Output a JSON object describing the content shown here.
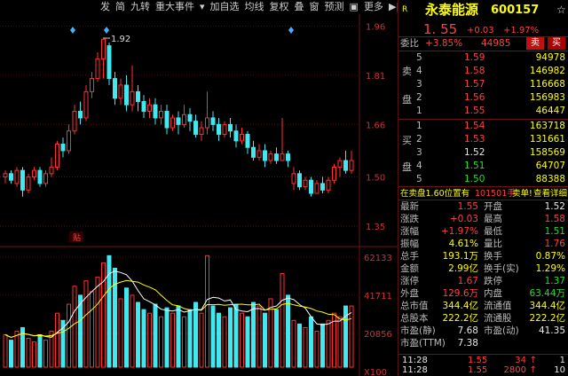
{
  "toolbar": {
    "items": [
      "发",
      "简",
      "九转",
      "重大事件",
      "加自选",
      "均线",
      "复权",
      "叠",
      "窗",
      "预测",
      "更多"
    ]
  },
  "stock": {
    "tag": "R",
    "name": "永泰能源",
    "code": "600157",
    "price": "1. 55",
    "change": "+0.03",
    "change_pct": "+1.97%",
    "star": "☆"
  },
  "weibi": {
    "label": "委比",
    "pct": "+3.85%",
    "value": "44985",
    "sell_btn": "卖",
    "buy_btn": "买"
  },
  "sell_orders": [
    {
      "level": "5",
      "price": "1.59",
      "vol": "94978"
    },
    {
      "level": "4",
      "price": "1.58",
      "vol": "146982"
    },
    {
      "level": "3",
      "price": "1.57",
      "vol": "116668"
    },
    {
      "level": "2",
      "price": "1.56",
      "vol": "156983"
    },
    {
      "level": "1",
      "price": "1.55",
      "vol": "46447"
    }
  ],
  "sell_side_label": [
    "卖",
    "盘"
  ],
  "buy_orders": [
    {
      "level": "1",
      "price": "1.54",
      "vol": "163718"
    },
    {
      "level": "2",
      "price": "1.53",
      "vol": "131661"
    },
    {
      "level": "3",
      "price": "1.52",
      "vol": "158569"
    },
    {
      "level": "4",
      "price": "1.51",
      "vol": "64707"
    },
    {
      "level": "5",
      "price": "1.50",
      "vol": "88388"
    }
  ],
  "buy_side_label": [
    "买",
    "盘"
  ],
  "notice": {
    "text_a": "在卖盘1.60位置有",
    "text_b": "101501手",
    "text_c": "卖单!",
    "link": "查看详细"
  },
  "stats": [
    {
      "l1": "最新",
      "v1": "1.55",
      "c1": "red",
      "l2": "开盘",
      "v2": "1.52",
      "c2": "white"
    },
    {
      "l1": "涨跌",
      "v1": "+0.03",
      "c1": "red",
      "l2": "最高",
      "v2": "1.58",
      "c2": "red"
    },
    {
      "l1": "涨幅",
      "v1": "+1.97%",
      "c1": "red",
      "l2": "最低",
      "v2": "1.51",
      "c2": "green"
    },
    {
      "l1": "振幅",
      "v1": "4.61%",
      "c1": "yellow",
      "l2": "量比",
      "v2": "1.76",
      "c2": "red"
    },
    {
      "l1": "总手",
      "v1": "193.1万",
      "c1": "yellow",
      "l2": "换手",
      "v2": "0.87%",
      "c2": "yellow"
    },
    {
      "l1": "金额",
      "v1": "2.99亿",
      "c1": "yellow",
      "l2": "换手(实)",
      "v2": "1.29%",
      "c2": "yellow"
    },
    {
      "l1": "涨停",
      "v1": "1.67",
      "c1": "red",
      "l2": "跌停",
      "v2": "1.37",
      "c2": "green"
    },
    {
      "l1": "外盘",
      "v1": "129.6万",
      "c1": "red",
      "l2": "内盘",
      "v2": "63.44万",
      "c2": "green"
    },
    {
      "l1": "总市值",
      "v1": "344.4亿",
      "c1": "yellow",
      "l2": "流通值",
      "v2": "344.4亿",
      "c2": "yellow"
    },
    {
      "l1": "总股本",
      "v1": "222.2亿",
      "c1": "yellow",
      "l2": "流通股",
      "v2": "222.2亿",
      "c2": "yellow"
    },
    {
      "l1": "市盈(静)",
      "v1": "7.68",
      "c1": "white",
      "l2": "市盈(动)",
      "v2": "41.35",
      "c2": "white"
    },
    {
      "l1": "市盈(TTM)",
      "v1": "7.38",
      "c1": "white",
      "l2": "",
      "v2": "",
      "c2": "white"
    }
  ],
  "ticks": [
    {
      "time": "11:28",
      "price": "1.55",
      "vol": "34",
      "arrow": "↑",
      "count": "1"
    },
    {
      "time": "11:28",
      "price": "1.55",
      "vol": "2800",
      "arrow": "↑",
      "count": "10"
    }
  ],
  "chart": {
    "price_axis": [
      "1.96",
      "1.81",
      "1.66",
      "1.50",
      "1.35"
    ],
    "volume_axis": [
      "62133",
      "41711",
      "20856",
      "X100"
    ],
    "high_annotation": "1.92",
    "event_label": "贴",
    "colors": {
      "up": "#ff3030",
      "down": "#40e8f0",
      "ma1": "#ffffff",
      "ma2": "#ffff00",
      "ma3": "#ff40ff"
    }
  },
  "chart_data": {
    "type": "candlestick",
    "ylim": [
      1.35,
      1.98
    ],
    "candles": [
      [
        1.5,
        1.51,
        1.48,
        1.52
      ],
      [
        1.51,
        1.49,
        1.48,
        1.52
      ],
      [
        1.48,
        1.52,
        1.47,
        1.53
      ],
      [
        1.52,
        1.46,
        1.44,
        1.53
      ],
      [
        1.46,
        1.5,
        1.45,
        1.51
      ],
      [
        1.5,
        1.52,
        1.49,
        1.53
      ],
      [
        1.52,
        1.48,
        1.47,
        1.53
      ],
      [
        1.48,
        1.51,
        1.47,
        1.52
      ],
      [
        1.51,
        1.53,
        1.5,
        1.56
      ],
      [
        1.53,
        1.6,
        1.52,
        1.61
      ],
      [
        1.6,
        1.58,
        1.56,
        1.62
      ],
      [
        1.58,
        1.64,
        1.57,
        1.66
      ],
      [
        1.64,
        1.7,
        1.63,
        1.72
      ],
      [
        1.7,
        1.68,
        1.66,
        1.73
      ],
      [
        1.68,
        1.76,
        1.67,
        1.78
      ],
      [
        1.76,
        1.8,
        1.74,
        1.82
      ],
      [
        1.8,
        1.86,
        1.79,
        1.88
      ],
      [
        1.86,
        1.92,
        1.8,
        1.92
      ],
      [
        1.9,
        1.8,
        1.78,
        1.91
      ],
      [
        1.8,
        1.74,
        1.72,
        1.82
      ],
      [
        1.74,
        1.78,
        1.72,
        1.8
      ],
      [
        1.78,
        1.72,
        1.7,
        1.81
      ],
      [
        1.72,
        1.76,
        1.7,
        1.84
      ],
      [
        1.76,
        1.73,
        1.7,
        1.78
      ],
      [
        1.73,
        1.7,
        1.68,
        1.75
      ],
      [
        1.7,
        1.72,
        1.68,
        1.74
      ],
      [
        1.72,
        1.68,
        1.66,
        1.74
      ],
      [
        1.68,
        1.7,
        1.66,
        1.72
      ],
      [
        1.7,
        1.65,
        1.63,
        1.72
      ],
      [
        1.65,
        1.68,
        1.64,
        1.69
      ],
      [
        1.68,
        1.66,
        1.63,
        1.7
      ],
      [
        1.66,
        1.69,
        1.65,
        1.72
      ],
      [
        1.69,
        1.67,
        1.64,
        1.71
      ],
      [
        1.67,
        1.63,
        1.62,
        1.69
      ],
      [
        1.63,
        1.65,
        1.61,
        1.67
      ],
      [
        1.65,
        1.68,
        1.63,
        1.76
      ],
      [
        1.68,
        1.66,
        1.64,
        1.7
      ],
      [
        1.66,
        1.63,
        1.61,
        1.68
      ],
      [
        1.63,
        1.66,
        1.62,
        1.67
      ],
      [
        1.66,
        1.64,
        1.62,
        1.68
      ],
      [
        1.64,
        1.61,
        1.59,
        1.66
      ],
      [
        1.61,
        1.63,
        1.6,
        1.65
      ],
      [
        1.63,
        1.59,
        1.57,
        1.64
      ],
      [
        1.59,
        1.56,
        1.55,
        1.61
      ],
      [
        1.56,
        1.58,
        1.55,
        1.6
      ],
      [
        1.58,
        1.55,
        1.53,
        1.6
      ],
      [
        1.55,
        1.57,
        1.54,
        1.58
      ],
      [
        1.57,
        1.55,
        1.54,
        1.59
      ],
      [
        1.55,
        1.57,
        1.55,
        1.68
      ],
      [
        1.57,
        1.55,
        1.53,
        1.58
      ],
      [
        1.48,
        1.51,
        1.46,
        1.53
      ],
      [
        1.51,
        1.47,
        1.46,
        1.52
      ],
      [
        1.47,
        1.49,
        1.46,
        1.5
      ],
      [
        1.49,
        1.45,
        1.44,
        1.5
      ],
      [
        1.45,
        1.48,
        1.45,
        1.49
      ],
      [
        1.48,
        1.46,
        1.45,
        1.5
      ],
      [
        1.46,
        1.49,
        1.45,
        1.5
      ],
      [
        1.49,
        1.53,
        1.48,
        1.54
      ],
      [
        1.53,
        1.55,
        1.5,
        1.56
      ],
      [
        1.55,
        1.52,
        1.51,
        1.58
      ],
      [
        1.52,
        1.55,
        1.51,
        1.58
      ]
    ],
    "volumes": [
      18,
      15,
      20,
      22,
      16,
      14,
      18,
      15,
      20,
      30,
      26,
      35,
      45,
      40,
      48,
      42,
      50,
      58,
      62,
      55,
      38,
      44,
      40,
      36,
      32,
      30,
      35,
      28,
      33,
      30,
      34,
      28,
      32,
      36,
      30,
      62,
      34,
      30,
      28,
      33,
      35,
      30,
      28,
      36,
      34,
      30,
      38,
      32,
      52,
      40,
      26,
      24,
      22,
      28,
      20,
      24,
      26,
      30,
      28,
      34,
      34
    ]
  }
}
